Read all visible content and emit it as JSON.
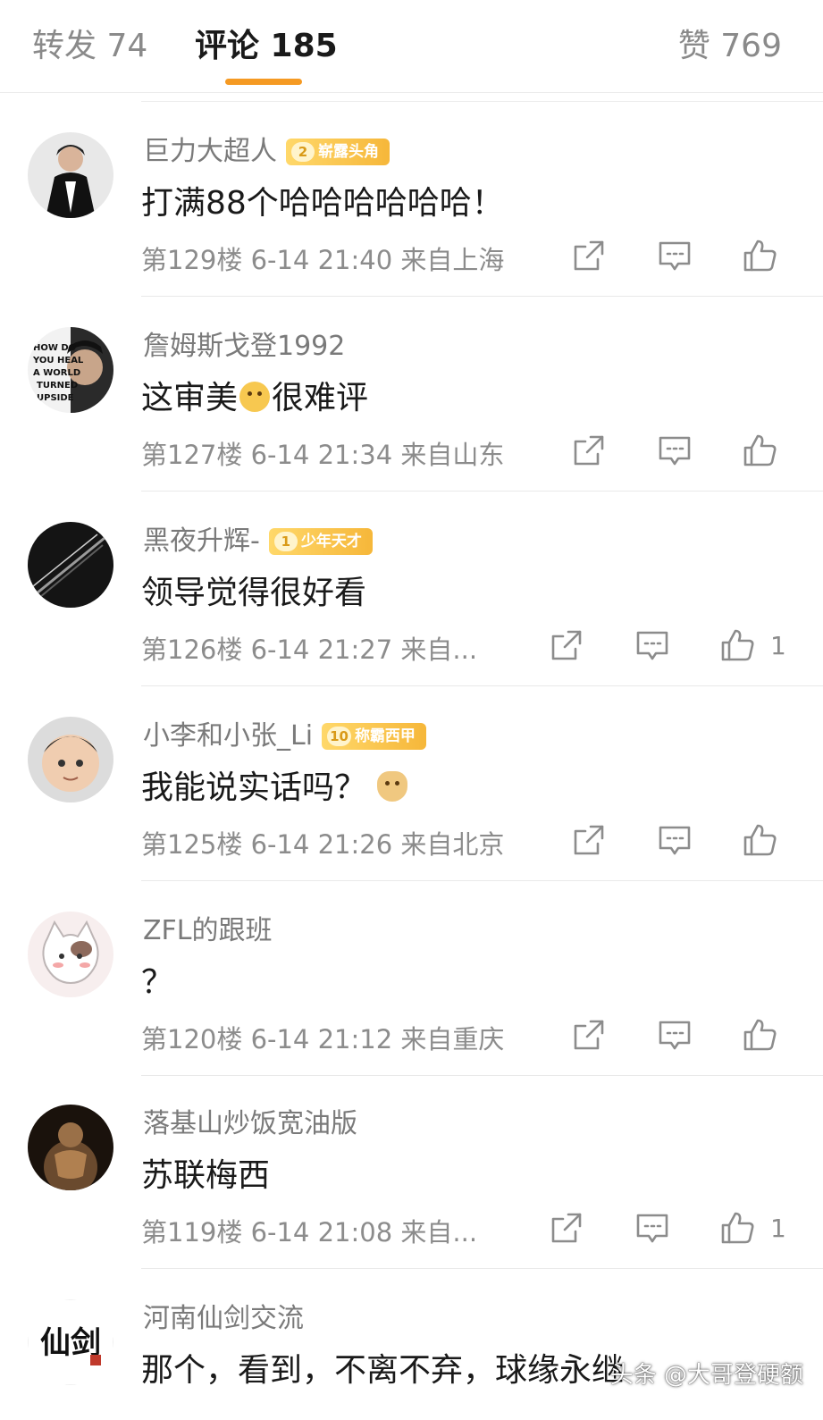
{
  "tabs": {
    "repost": "转发 74",
    "comments": "评论 185",
    "likes": "赞 769"
  },
  "comments": [
    {
      "user": "巨力大超人",
      "badge_level": "2",
      "badge_text": "崭露头角",
      "text": "打满88个哈哈哈哈哈哈！",
      "meta": "第129楼 6-14 21:40 来自上海",
      "likes": ""
    },
    {
      "user": "詹姆斯戈登1992",
      "text_before": "这审美",
      "text_after": "很难评",
      "emoji": "emoji-face",
      "meta": "第127楼 6-14 21:34 来自山东",
      "likes": ""
    },
    {
      "user": "黑夜升辉-",
      "badge_level": "1",
      "badge_text": "少年天才",
      "text": "领导觉得很好看",
      "meta": "第126楼 6-14 21:27 来自...",
      "likes": "1"
    },
    {
      "user": "小李和小张_Li",
      "badge_level": "10",
      "badge_text": "称霸西甲",
      "text": "我能说实话吗？",
      "emoji": "doge-emoji",
      "meta": "第125楼 6-14 21:26 来自北京",
      "likes": ""
    },
    {
      "user": "ZFL的跟班",
      "text": "？",
      "meta": "第120楼 6-14 21:12 来自重庆",
      "likes": ""
    },
    {
      "user": "落基山炒饭宽油版",
      "text": "苏联梅西",
      "meta": "第119楼 6-14 21:08 来自...",
      "likes": "1"
    },
    {
      "user": "河南仙剑交流",
      "text": "那个，看到，不离不弃，球缘永继",
      "avatar_text": "仙剑"
    }
  ],
  "avatar_lettering": "HOW DO YOU HEAL A WORLD TURNED UPSIDE DOWN?",
  "watermark": "头条 @大哥登硬额",
  "colors": {
    "accent": "#f59a23",
    "badge": "#f6b73a",
    "meta": "#8c8c8c"
  },
  "icons": [
    "share-icon",
    "reply-icon",
    "like-icon"
  ]
}
